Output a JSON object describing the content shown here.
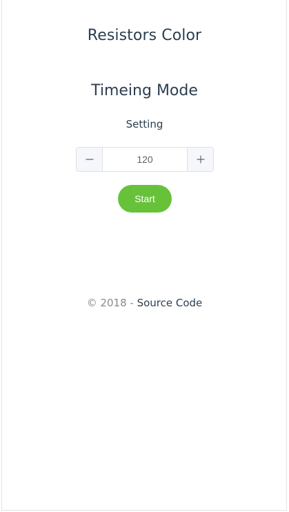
{
  "app": {
    "title": "Resistors Color"
  },
  "mode": {
    "title": "Timeing Mode",
    "setting_label": "Setting"
  },
  "stepper": {
    "value": "120",
    "decrement_icon": "minus-icon",
    "increment_icon": "plus-icon"
  },
  "actions": {
    "start_label": "Start"
  },
  "footer": {
    "copyright": "© 2018 - ",
    "link_label": "Source Code"
  },
  "colors": {
    "primary_text": "#2c3e50",
    "start_button": "#67c23a",
    "border": "#dcdfe6",
    "stepper_button_bg": "#f5f7fa"
  }
}
